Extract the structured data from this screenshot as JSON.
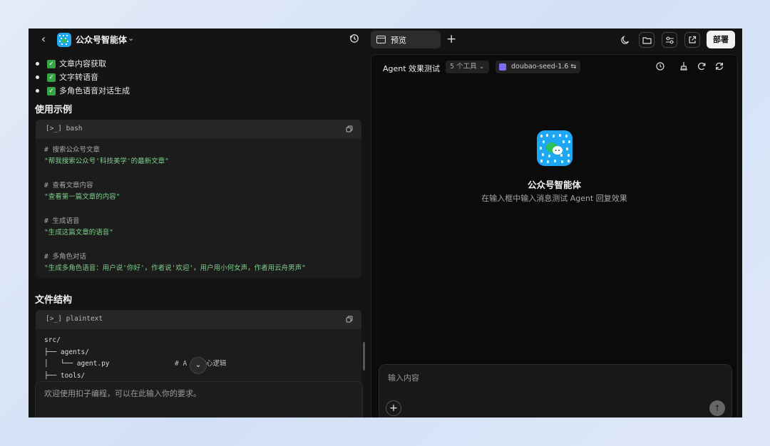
{
  "left_header": {
    "back_icon": "chevron-left-icon",
    "app_name": "公众号智能体",
    "dropdown_icon": "chevron-down-icon",
    "history_icon": "history-icon"
  },
  "features": [
    {
      "label": "文章内容获取"
    },
    {
      "label": "文字转语音"
    },
    {
      "label": "多角色语音对话生成"
    }
  ],
  "usage": {
    "heading": "使用示例",
    "lang": "bash",
    "lang_prefix": "[>_]",
    "lines": [
      {
        "comment": "# 搜索公众号文章",
        "string": "\"帮我搜索公众号'科技美学'的最新文章\""
      },
      {
        "comment": "# 查看文章内容",
        "string": "\"查看第一篇文章的内容\""
      },
      {
        "comment": "# 生成语音",
        "string": "\"生成这篇文章的语音\""
      },
      {
        "comment": "# 多角色对话",
        "string": "\"生成多角色语音：用户说'你好'，作者说'欢迎'，用户用小何女声，作者用云舟男声\""
      }
    ]
  },
  "files": {
    "heading": "文件结构",
    "lang": "plaintext",
    "lang_prefix": "[>_]",
    "line1": "src/",
    "line2": "├── agents/",
    "line3": "│   └── agent.py",
    "line3_comment": "# A   核心逻辑",
    "line4": "├── tools/"
  },
  "left_prompt": {
    "placeholder": "欢迎使用扣子编程，可以在此输入你的要求。"
  },
  "tabbar": {
    "preview_tab": "预览",
    "add_icon": "plus-icon",
    "deploy_label": "部署",
    "icons": [
      "moon-icon",
      "folder-icon",
      "settings-sliders-icon",
      "external-link-icon"
    ]
  },
  "preview": {
    "title": "Agent 效果测试",
    "tools_badge": "5 个工具 ⌄",
    "model_badge": "doubao-seed-1.6 ⇆",
    "agent_name": "公众号智能体",
    "agent_hint": "在输入框中输入消息测试 Agent 回复效果",
    "input_placeholder": "输入内容",
    "header_icons": [
      "history-icon",
      "broom-icon",
      "refresh-icon",
      "sync-icon"
    ]
  },
  "colors": {
    "accent_blue": "#1ea7f2",
    "string_green": "#7fce8d",
    "check_green": "#37a446"
  }
}
